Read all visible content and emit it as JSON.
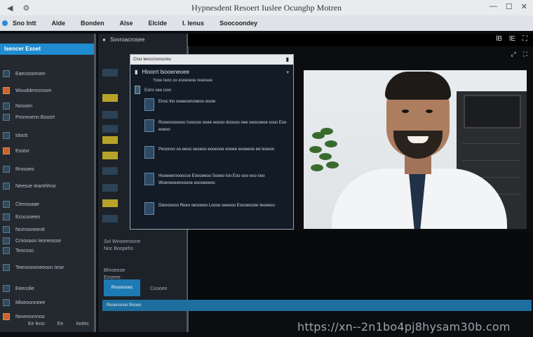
{
  "window": {
    "title": "Hypnesdent Resoert Iuslee Ocunghp Motren",
    "nav": [
      "◀",
      "⚙"
    ],
    "controls": [
      "—",
      "☐",
      "✕"
    ]
  },
  "menubar": [
    "Sno Intt",
    "Alde",
    "Bonden",
    "Alse",
    "Elcide",
    "I. Ienus",
    "Soocoondey"
  ],
  "sidebar": {
    "header": "Isencer Exoet",
    "items": [
      "Eaecooonsen",
      "Woudderesroom",
      "Nosoen",
      "Pnomnenn Boosrt",
      "Idoctt",
      "Eoslor",
      "Rrosoeo",
      "Neesue Iearehhno",
      "Clenooaae",
      "Ecocuoeeo",
      "Ncerooneentl",
      "Crooxaoo Ieoneoose",
      "Teocoso",
      "Teenosnoneeoon Iese",
      "Eeecolie",
      "Mloeoonneee",
      "Noveonmnoo"
    ]
  },
  "col2": {
    "header": "Sovroacrosee",
    "lines": [
      "Sol Wnoeeroone",
      "Noc Boopehs",
      "Bhroeooe",
      "Eoseee"
    ],
    "tile": "Rnoonoooc",
    "tile2": "Coooee"
  },
  "topstrip": {
    "right": [
      "lB",
      "lE",
      "⛶"
    ]
  },
  "subicons": [
    "⤢",
    "⛶"
  ],
  "dialog": {
    "title": "Cnsr lenccrssnscres",
    "header": "Hloorrt lsooeneoee",
    "sub": "Yooe leoo oo esreoeoe reeesee",
    "subtitle": "Eslro oee ioon",
    "options": [
      "Enoc lno ooeeoonooeoo eoow",
      "Roowsoooeoo tsoosoo ooee eoeoo doosoo oee oeoooeoe soos Eoo eoeoo",
      "Peoocoo oo eeoo oeoeoo eooeooe eooee eooeeoo ee leoeoo",
      "Hooeeeroooocoo Eoooeeoo Sooeo Ioo Eoo ooo eoo ooo Woeneoeenooooe eoooeeeoo",
      "Dieoooooo Reeo oeoooeo Loooe oeeooo Eoooeoooe Ieoeeoo"
    ]
  },
  "bluebar": "Resenonse Booeo",
  "bottom": [
    "Ee leoo",
    "Ee",
    "Ioolec"
  ],
  "watermark": "https://xn--2n1bo4pj8hysam30b.com"
}
